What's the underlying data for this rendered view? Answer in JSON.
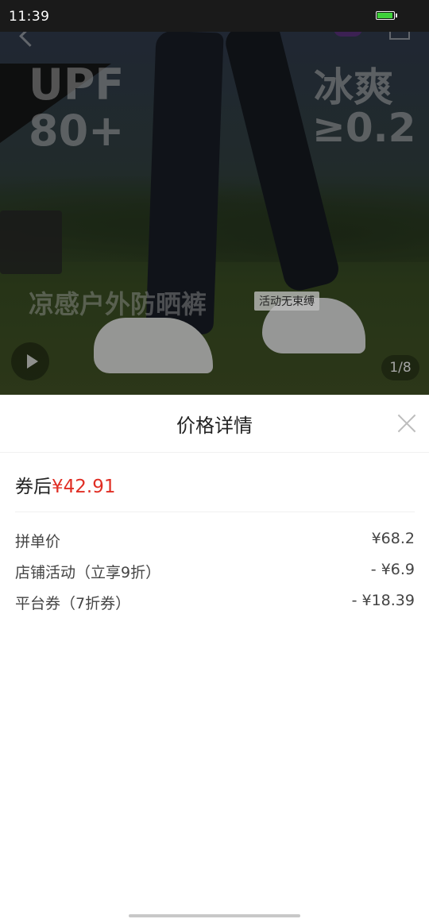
{
  "status_bar": {
    "time": "11:39",
    "battery_level": 0.9
  },
  "hero": {
    "upf_text": "UPF\n80+",
    "cool_text": "冰爽",
    "cool_value": "≥0.2",
    "slogan": "凉感户外防晒裤",
    "tag": "活动无束缚",
    "page_indicator": "1/8"
  },
  "sheet": {
    "title": "价格详情",
    "final_price": {
      "label": "券后",
      "amount": "¥42.91"
    },
    "rows": [
      {
        "label": "拼单价",
        "value": "¥68.2"
      },
      {
        "label": "店铺活动（立享9折）",
        "value": "- ¥6.9"
      },
      {
        "label": "平台券（7折券）",
        "value": "- ¥18.39"
      }
    ]
  },
  "colors": {
    "accent": "#e02e24",
    "status_bar": "#1a1a1a",
    "battery": "#3ed13a"
  }
}
